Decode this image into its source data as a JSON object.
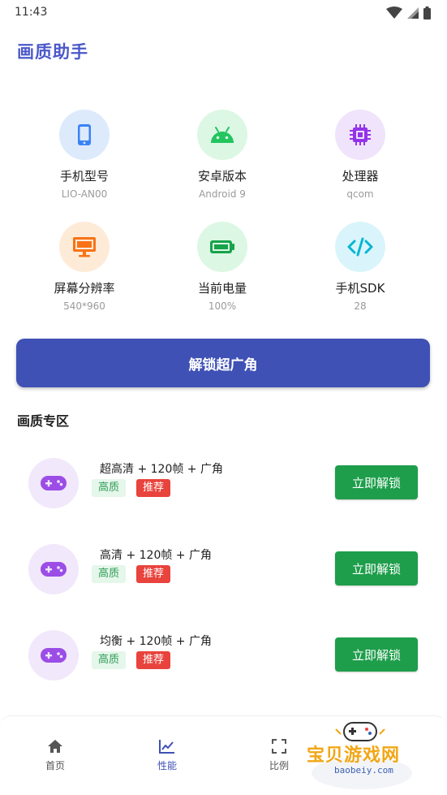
{
  "status_bar": {
    "time": "11:43"
  },
  "header": {
    "title": "画质助手"
  },
  "device_info": [
    {
      "label": "手机型号",
      "value": "LIO-AN00",
      "icon": "phone-icon",
      "bg": "#dceafb",
      "fg": "#3b82f6"
    },
    {
      "label": "安卓版本",
      "value": "Android 9",
      "icon": "android-icon",
      "bg": "#dcf7e4",
      "fg": "#22c55e"
    },
    {
      "label": "处理器",
      "value": "qcom",
      "icon": "cpu-icon",
      "bg": "#efe4fb",
      "fg": "#9333ea"
    },
    {
      "label": "屏幕分辨率",
      "value": "540*960",
      "icon": "monitor-icon",
      "bg": "#fdebd8",
      "fg": "#f97316"
    },
    {
      "label": "当前电量",
      "value": "100%",
      "icon": "battery-icon",
      "bg": "#dcf7e4",
      "fg": "#16a34a"
    },
    {
      "label": "手机SDK",
      "value": "28",
      "icon": "code-icon",
      "bg": "#d9f5fb",
      "fg": "#06b6d4"
    }
  ],
  "unlock_wide_button": {
    "label": "解锁超广角"
  },
  "quality_section": {
    "title": "画质专区",
    "items": [
      {
        "title": "超高清 + 120帧 + 广角",
        "tag_quality": "高质",
        "tag_recommend": "推荐",
        "button": "立即解锁"
      },
      {
        "title": "高清 + 120帧 + 广角",
        "tag_quality": "高质",
        "tag_recommend": "推荐",
        "button": "立即解锁"
      },
      {
        "title": "均衡 + 120帧 + 广角",
        "tag_quality": "高质",
        "tag_recommend": "推荐",
        "button": "立即解锁"
      }
    ]
  },
  "bottom_nav": {
    "items": [
      {
        "label": "首页",
        "icon": "home-icon",
        "active": false
      },
      {
        "label": "性能",
        "icon": "chart-icon",
        "active": true
      },
      {
        "label": "比例",
        "icon": "fullscreen-icon",
        "active": false
      }
    ]
  },
  "watermark": {
    "text": "宝贝游戏网",
    "url": "baobeiy.com"
  },
  "colors": {
    "accent": "#3f51b5",
    "title": "#4b58c9",
    "unlock_green": "#1e9e4b",
    "recommend_red": "#e8433c"
  }
}
